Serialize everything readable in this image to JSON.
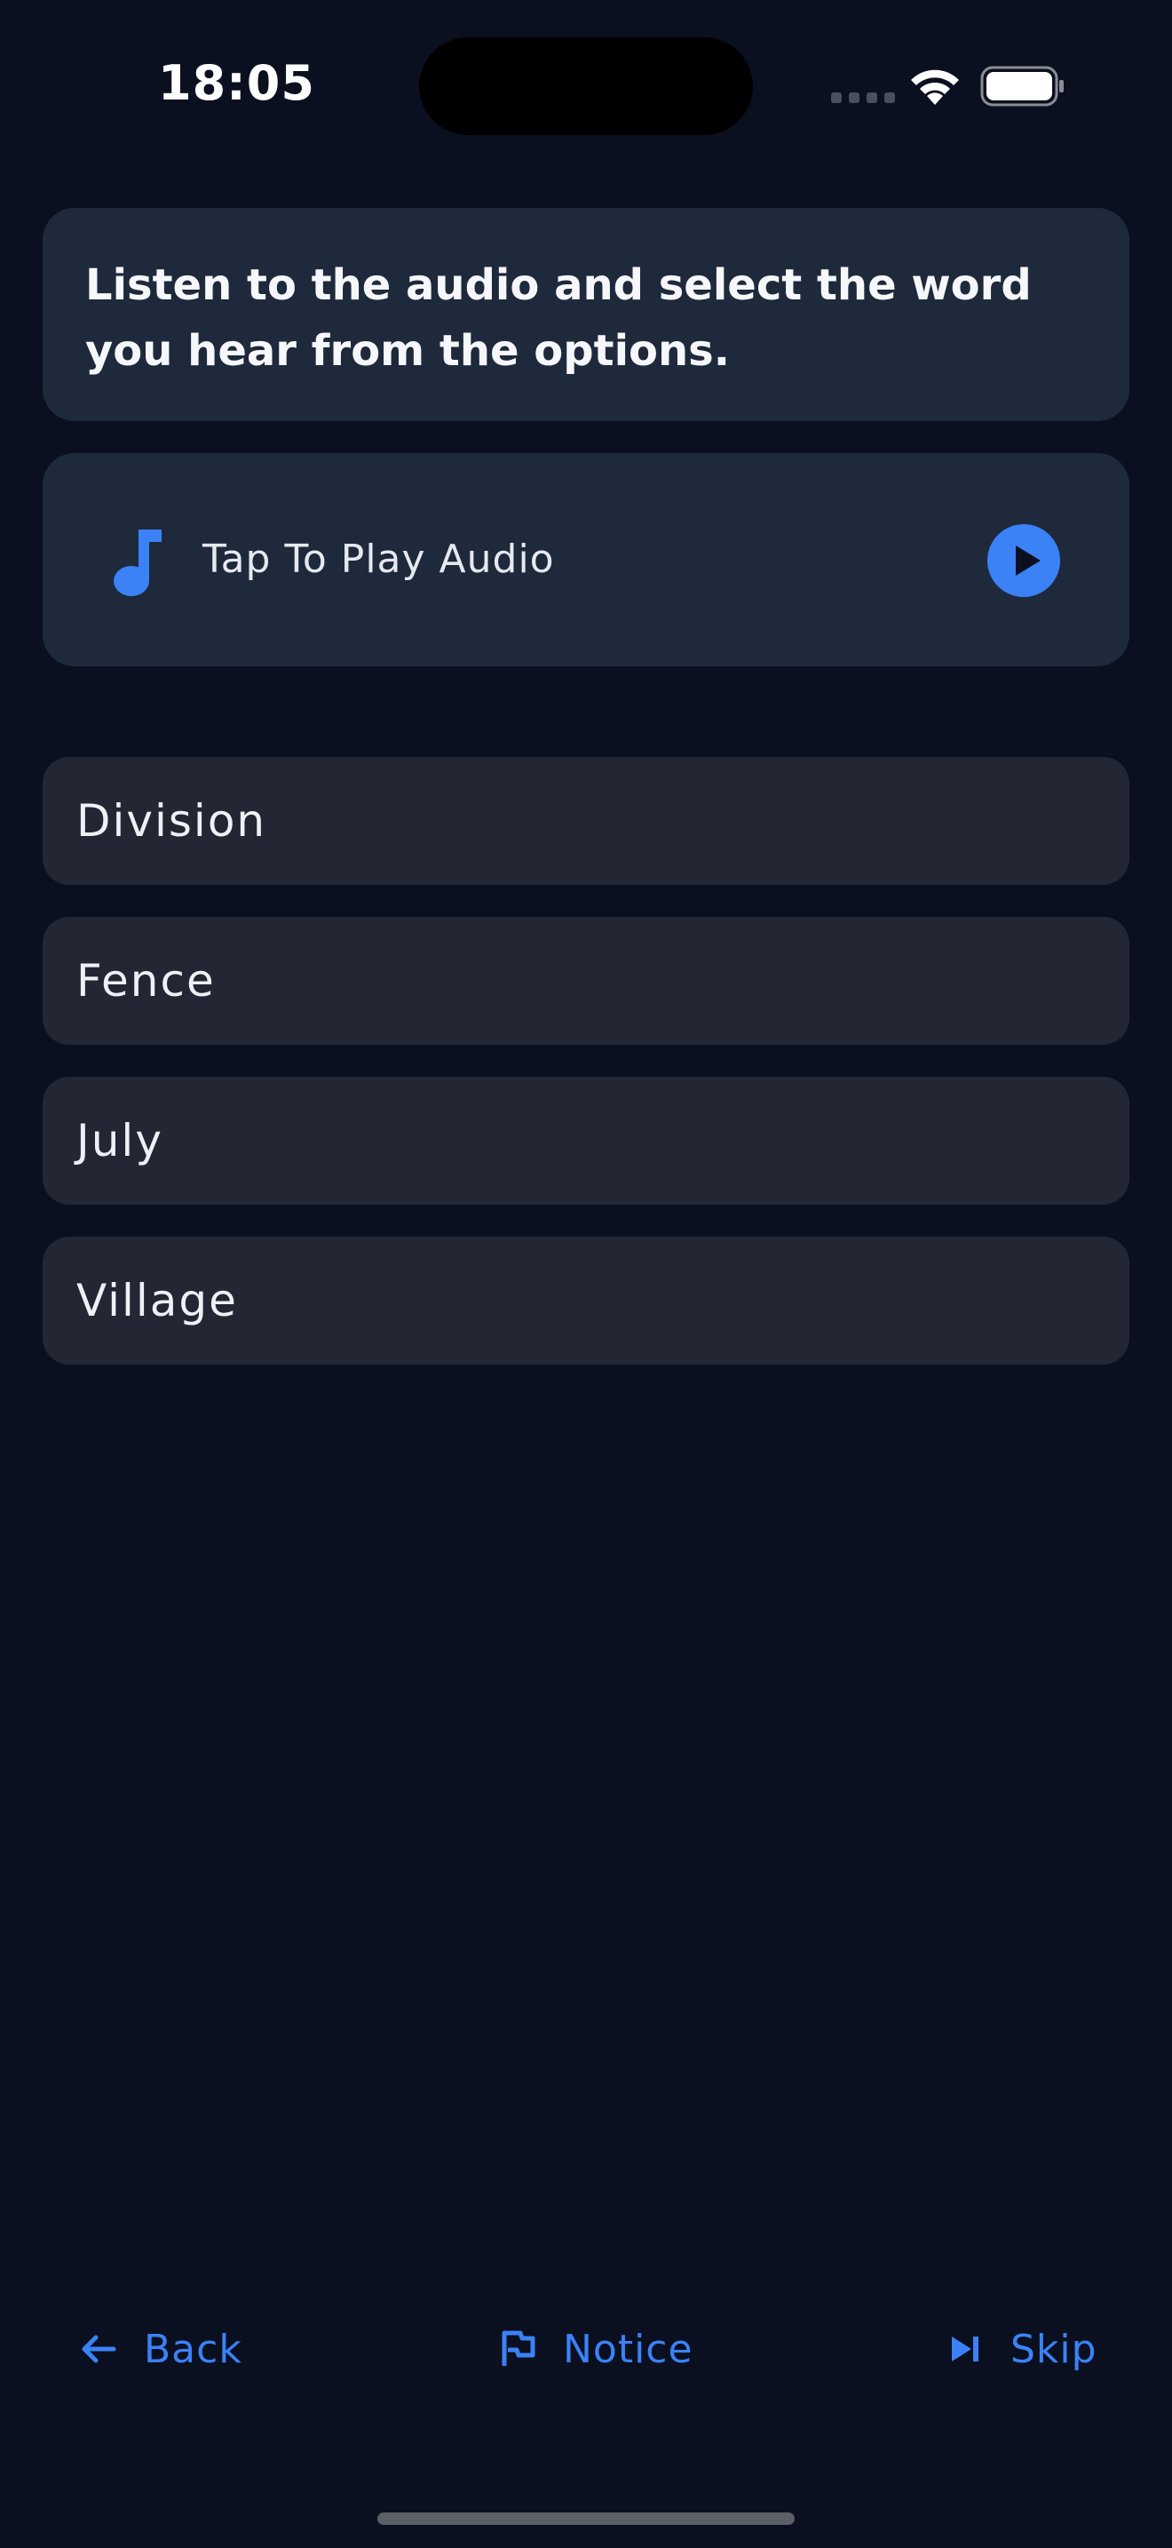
{
  "status_bar": {
    "time": "18:05"
  },
  "instruction": {
    "text": "Listen to the audio and select the word you hear from the options."
  },
  "audio": {
    "label": "Tap To Play Audio",
    "icon": "music-note-icon",
    "play_icon": "play-icon"
  },
  "options": [
    {
      "label": "Division"
    },
    {
      "label": "Fence"
    },
    {
      "label": "July"
    },
    {
      "label": "Village"
    }
  ],
  "nav": {
    "back_label": "Back",
    "back_icon": "arrow-left-icon",
    "notice_label": "Notice",
    "notice_icon": "flag-icon",
    "skip_label": "Skip",
    "skip_icon": "skip-next-icon"
  },
  "colors": {
    "background": "#0b1020",
    "card": "#1e293b",
    "option": "#232733",
    "accent": "#3b82f6"
  }
}
